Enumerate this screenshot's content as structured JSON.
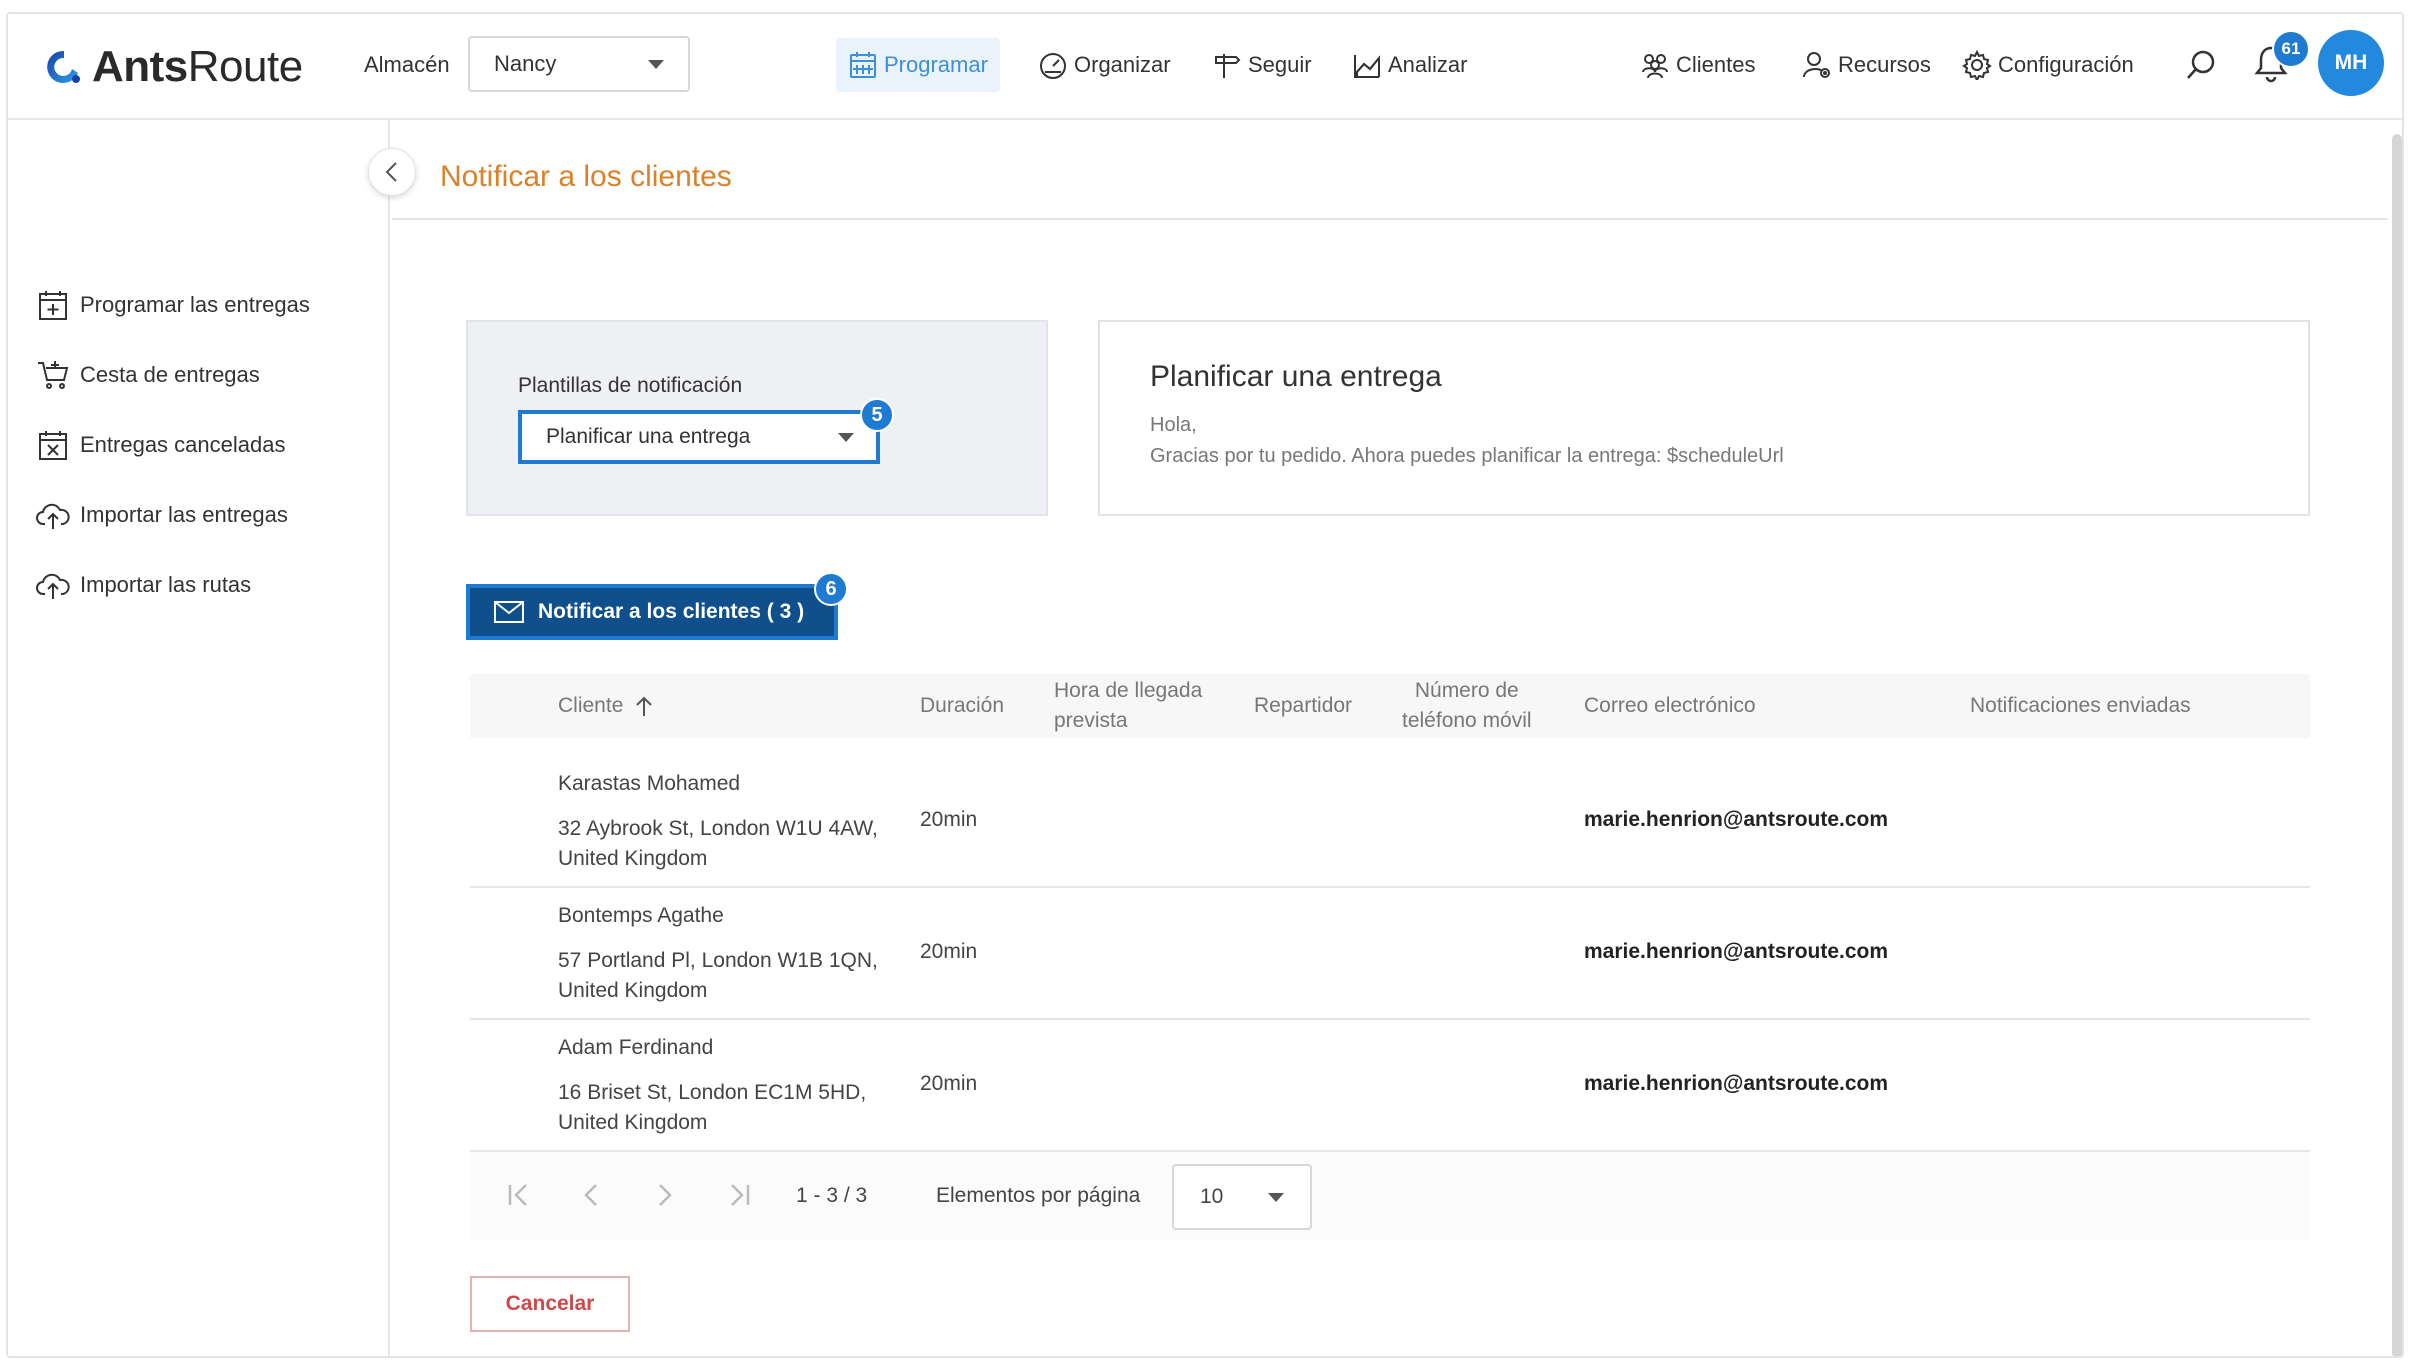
{
  "header": {
    "logo_ants": "Ants",
    "logo_route": "Route",
    "warehouse_label": "Almacén",
    "warehouse_value": "Nancy",
    "nav": [
      {
        "label": "Programar",
        "icon": "calendar-grid-icon"
      },
      {
        "label": "Organizar",
        "icon": "gauge-icon"
      },
      {
        "label": "Seguir",
        "icon": "signpost-icon"
      },
      {
        "label": "Analizar",
        "icon": "chart-icon"
      }
    ],
    "right_nav": [
      {
        "label": "Clientes",
        "icon": "people-icon"
      },
      {
        "label": "Recursos",
        "icon": "user-gear-icon"
      },
      {
        "label": "Configuración",
        "icon": "gear-icon"
      }
    ],
    "notifications_count": "61",
    "avatar_initials": "MH"
  },
  "sidebar": {
    "items": [
      {
        "label": "Programar las entregas",
        "icon": "calendar-plus-icon"
      },
      {
        "label": "Cesta de entregas",
        "icon": "cart-icon"
      },
      {
        "label": "Entregas canceladas",
        "icon": "calendar-x-icon"
      },
      {
        "label": "Importar las entregas",
        "icon": "cloud-upload-icon"
      },
      {
        "label": "Importar las rutas",
        "icon": "cloud-upload-icon"
      }
    ]
  },
  "main": {
    "title": "Notificar a los clientes",
    "template_label": "Plantillas de notificación",
    "template_value": "Planificar una entrega",
    "step_template": "5",
    "step_notify": "6",
    "preview_title": "Planificar una entrega",
    "preview_line1": "Hola,",
    "preview_line2": "Gracias por tu pedido. Ahora puedes planificar la entrega: $scheduleUrl",
    "notify_button": "Notificar a los clientes ( 3 )",
    "cancel_button": "Cancelar"
  },
  "table": {
    "headers": {
      "client": "Cliente",
      "duration": "Duración",
      "eta_1": "Hora de llegada",
      "eta_2": "prevista",
      "driver": "Repartidor",
      "phone_1": "Número de",
      "phone_2": "teléfono móvil",
      "email": "Correo electrónico",
      "sent": "Notificaciones enviadas"
    },
    "rows": [
      {
        "name": "Karastas Mohamed",
        "addr1": "32 Aybrook St, London W1U 4AW,",
        "addr2": "United Kingdom",
        "duration": "20min",
        "email": "marie.henrion@antsroute.com"
      },
      {
        "name": "Bontemps Agathe",
        "addr1": "57 Portland Pl, London W1B 1QN,",
        "addr2": "United Kingdom",
        "duration": "20min",
        "email": "marie.henrion@antsroute.com"
      },
      {
        "name": "Adam Ferdinand",
        "addr1": "16 Briset St, London EC1M 5HD,",
        "addr2": "United Kingdom",
        "duration": "20min",
        "email": "marie.henrion@antsroute.com"
      }
    ],
    "pager": {
      "range": "1 - 3 / 3",
      "per_page_label": "Elementos por página",
      "per_page_value": "10"
    }
  },
  "colors": {
    "accent": "#1f7ad1",
    "title_orange": "#d9822b",
    "notify_button": "#0e4f8c",
    "cancel_red": "#d04848"
  }
}
